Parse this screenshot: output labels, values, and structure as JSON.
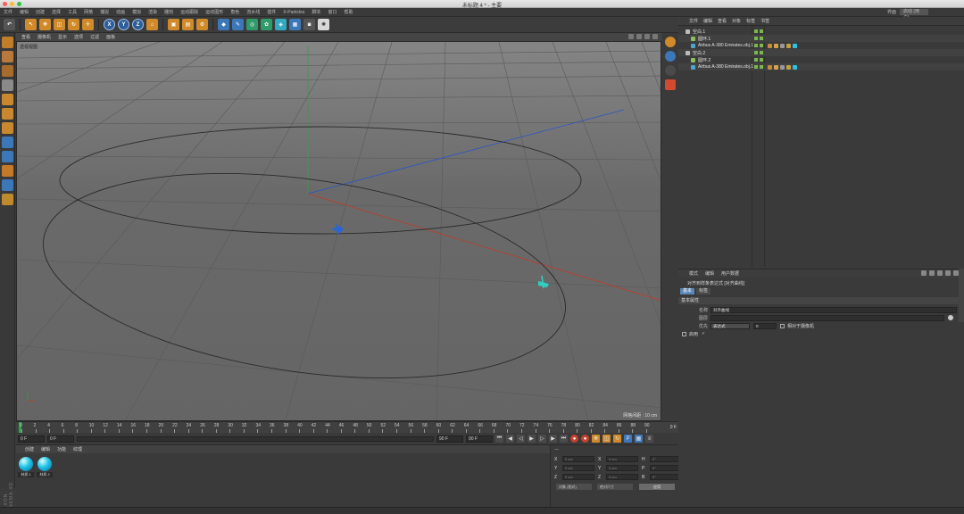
{
  "window": {
    "title": "未标题 4 * - 主要",
    "colors": {
      "close": "#ff5f57",
      "minimize": "#febc2e",
      "zoom": "#28c840"
    }
  },
  "menubar": {
    "items": [
      "文件",
      "编辑",
      "创建",
      "选择",
      "工具",
      "网格",
      "捕捉",
      "动画",
      "模拟",
      "渲染",
      "雕刻",
      "运动跟踪",
      "运动图形",
      "角色",
      "流水线",
      "插件",
      "X-Particles",
      "脚本",
      "窗口",
      "帮助"
    ],
    "layout_label": "界面",
    "layout_value": "启动 (用户)"
  },
  "viewport": {
    "menu": [
      "查看",
      "摄像机",
      "显示",
      "选项",
      "过滤",
      "面板"
    ],
    "camera_label": "透视视图",
    "grid_spacing": "网格间距 : 10 cm"
  },
  "timeline": {
    "ticks": [
      "0",
      "2",
      "4",
      "6",
      "8",
      "10",
      "12",
      "14",
      "16",
      "18",
      "20",
      "22",
      "24",
      "26",
      "28",
      "30",
      "32",
      "34",
      "36",
      "38",
      "40",
      "42",
      "44",
      "46",
      "48",
      "50",
      "52",
      "54",
      "56",
      "58",
      "60",
      "62",
      "64",
      "66",
      "68",
      "70",
      "72",
      "74",
      "76",
      "78",
      "80",
      "82",
      "84",
      "86",
      "88",
      "90"
    ],
    "current_frame": "0 F"
  },
  "transport": {
    "start_field": "0 F",
    "min_field": "0 F",
    "max_field": "90 F",
    "end_field": "90 F"
  },
  "materials": {
    "menu": [
      "创建",
      "编辑",
      "功能",
      "纹理"
    ],
    "items": [
      {
        "label": "材质.1"
      },
      {
        "label": "材质.2"
      }
    ]
  },
  "maxon": "MAXON CINEMA 4D",
  "coordinates": {
    "header": "—",
    "rows": [
      {
        "a": "X",
        "a_val": "0 cm",
        "b": "X",
        "b_val": "0 cm",
        "c": "H",
        "c_val": "0°"
      },
      {
        "a": "Y",
        "a_val": "0 cm",
        "b": "Y",
        "b_val": "0 cm",
        "c": "P",
        "c_val": "0°"
      },
      {
        "a": "Z",
        "a_val": "0 cm",
        "b": "Z",
        "b_val": "0 cm",
        "c": "B",
        "c_val": "0°"
      }
    ],
    "mode1": "对象 (相对)",
    "mode2": "绝对尺寸",
    "apply": "应用"
  },
  "object_manager": {
    "menu": [
      "文件",
      "编辑",
      "查看",
      "对象",
      "标签",
      "书签"
    ],
    "objects": [
      {
        "name": "空白.1",
        "indent": 0,
        "type": "null"
      },
      {
        "name": "圆环.1",
        "indent": 1,
        "type": "spline"
      },
      {
        "name": "Airbus A-380 Emirates.obj.1",
        "indent": 1,
        "type": "plane"
      },
      {
        "name": "空白.2",
        "indent": 0,
        "type": "null"
      },
      {
        "name": "圆环.2",
        "indent": 1,
        "type": "spline"
      },
      {
        "name": "Airbus A-380 Emirates.obj.1",
        "indent": 1,
        "type": "plane"
      }
    ]
  },
  "attribute_manager": {
    "menu": [
      "模式",
      "编辑",
      "用户数据"
    ],
    "title": "对齐到样条表达式 [对齐曲线]",
    "tabs": [
      "基本",
      "标签"
    ],
    "section": "基本属性",
    "fields": [
      {
        "key": "名称",
        "value": "对齐曲线"
      },
      {
        "key": "图层",
        "value": ""
      },
      {
        "key": "优先",
        "value": "表达式"
      }
    ],
    "priority_number": "0",
    "camera_check_label": "相对于摄像机",
    "enabled_label": "启用"
  },
  "chart_colors": {
    "x_axis": "#c23b2a",
    "y_axis": "#2fa04a",
    "z_axis": "#2c55c8",
    "spline": "#2a2a2a"
  }
}
